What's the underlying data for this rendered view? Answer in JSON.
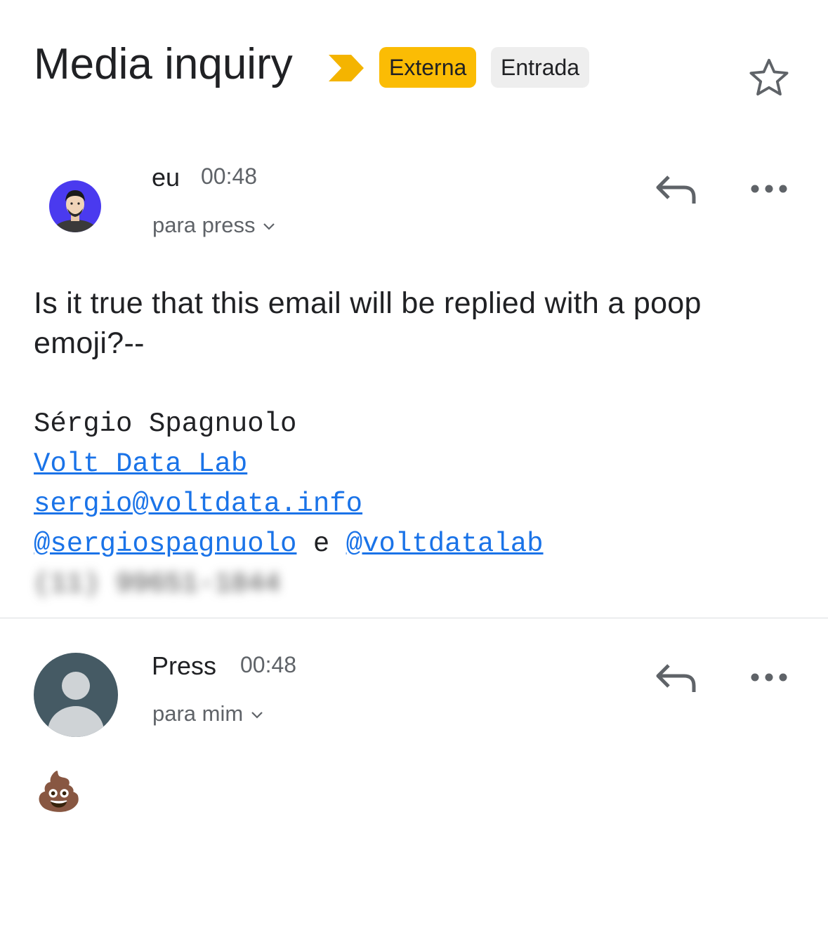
{
  "thread": {
    "subject": "Media inquiry",
    "labels": [
      {
        "text": "Externa",
        "color": "#fbbc04"
      },
      {
        "text": "Entrada",
        "color": "#eeeeee"
      }
    ],
    "importance_marker_color": "#f4b400"
  },
  "messages": [
    {
      "sender": "eu",
      "time": "00:48",
      "recipient": "para press",
      "avatar": "profile-photo",
      "body": "Is it true that this email will be replied with a poop emoji?--",
      "signature": {
        "name": "Sérgio Spagnuolo",
        "org_link": "Volt Data Lab",
        "email_link": "sergio@voltdata.info",
        "handle_1": "@sergiospagnuolo",
        "conjunction": "e",
        "handle_2": "@voltdatalab",
        "phone_blurred": "(11) 99651-1844"
      }
    },
    {
      "sender": "Press",
      "time": "00:48",
      "recipient": "para mim",
      "avatar": "default-person",
      "body": "💩"
    }
  ],
  "colors": {
    "link": "#1a73e8",
    "secondary_text": "#5f6368",
    "avatar_purple": "#4a3aef",
    "avatar_default_bg": "#455a64"
  }
}
